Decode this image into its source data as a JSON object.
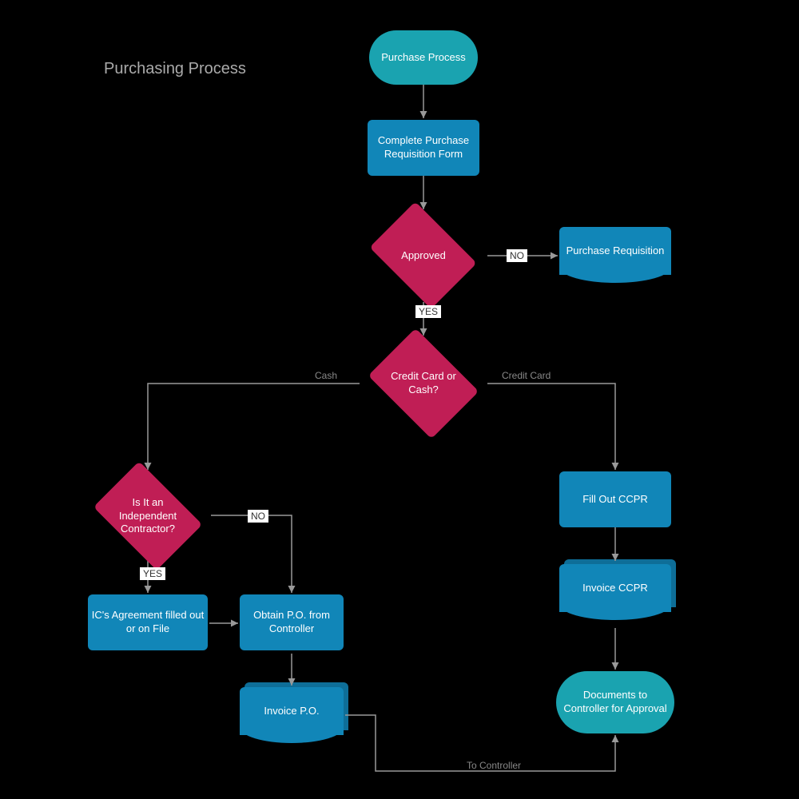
{
  "title": "Purchasing Process",
  "nodes": {
    "start": "Purchase Process",
    "completeForm": "Complete Purchase Requisition Form",
    "approved": "Approved",
    "purchaseReq": "Purchase Requisition",
    "creditOrCash": "Credit Card or Cash?",
    "independent": "Is It an Independent Contractor?",
    "icAgreement": "IC's Agreement filled out or on File",
    "obtainPO": "Obtain P.O. from Controller",
    "invoicePO": "Invoice P.O.",
    "fillCCPR": "Fill Out CCPR",
    "invoiceCCPR": "Invoice CCPR",
    "docsController": "Documents to Controller for Approval"
  },
  "edges": {
    "no": "NO",
    "yes": "YES",
    "cash": "Cash",
    "creditCard": "Credit Card",
    "toController": "To Controller"
  }
}
